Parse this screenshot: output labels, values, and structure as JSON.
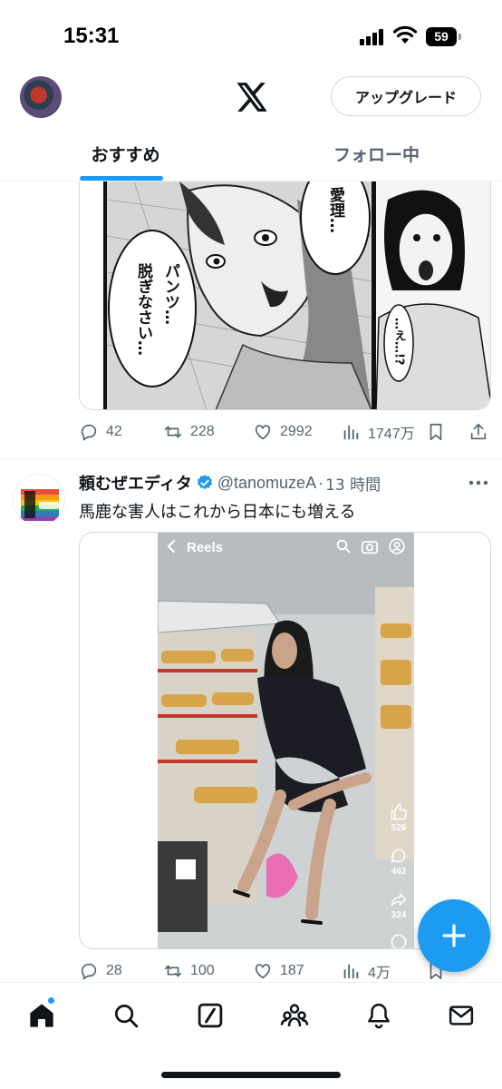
{
  "status_bar": {
    "time": "15:31",
    "battery": "59"
  },
  "header": {
    "logo": "x-logo",
    "upgrade_label": "アップグレード"
  },
  "tabs": [
    {
      "label": "おすすめ",
      "active": true
    },
    {
      "label": "フォロー中",
      "active": false
    }
  ],
  "tweet1": {
    "manga": {
      "bubble_left": "パンツ…\n脱ぎなさい…",
      "bubble_top": "愛理…",
      "bubble_right": "…え…!?"
    },
    "actions": {
      "replies": "42",
      "reposts": "228",
      "likes": "2992",
      "views": "1747万"
    }
  },
  "tweet2": {
    "name": "頼むぜエディタ",
    "handle": "@tanomuzeA",
    "separator": "·",
    "time": "13 時間",
    "text": "馬鹿な害人はこれから日本にも増える",
    "video": {
      "reels_label": "Reels",
      "stats": {
        "likes": "526",
        "comments": "462",
        "shares": "324"
      }
    },
    "actions": {
      "replies": "28",
      "reposts": "100",
      "likes": "187",
      "views": "4万"
    }
  },
  "bottom_nav": [
    {
      "icon": "home-icon",
      "active": true,
      "badge": true
    },
    {
      "icon": "search-icon"
    },
    {
      "icon": "grok-icon"
    },
    {
      "icon": "communities-icon"
    },
    {
      "icon": "notifications-icon"
    },
    {
      "icon": "messages-icon"
    }
  ],
  "colors": {
    "accent": "#1d9bf0",
    "text": "#0f1419",
    "secondary": "#536471"
  }
}
